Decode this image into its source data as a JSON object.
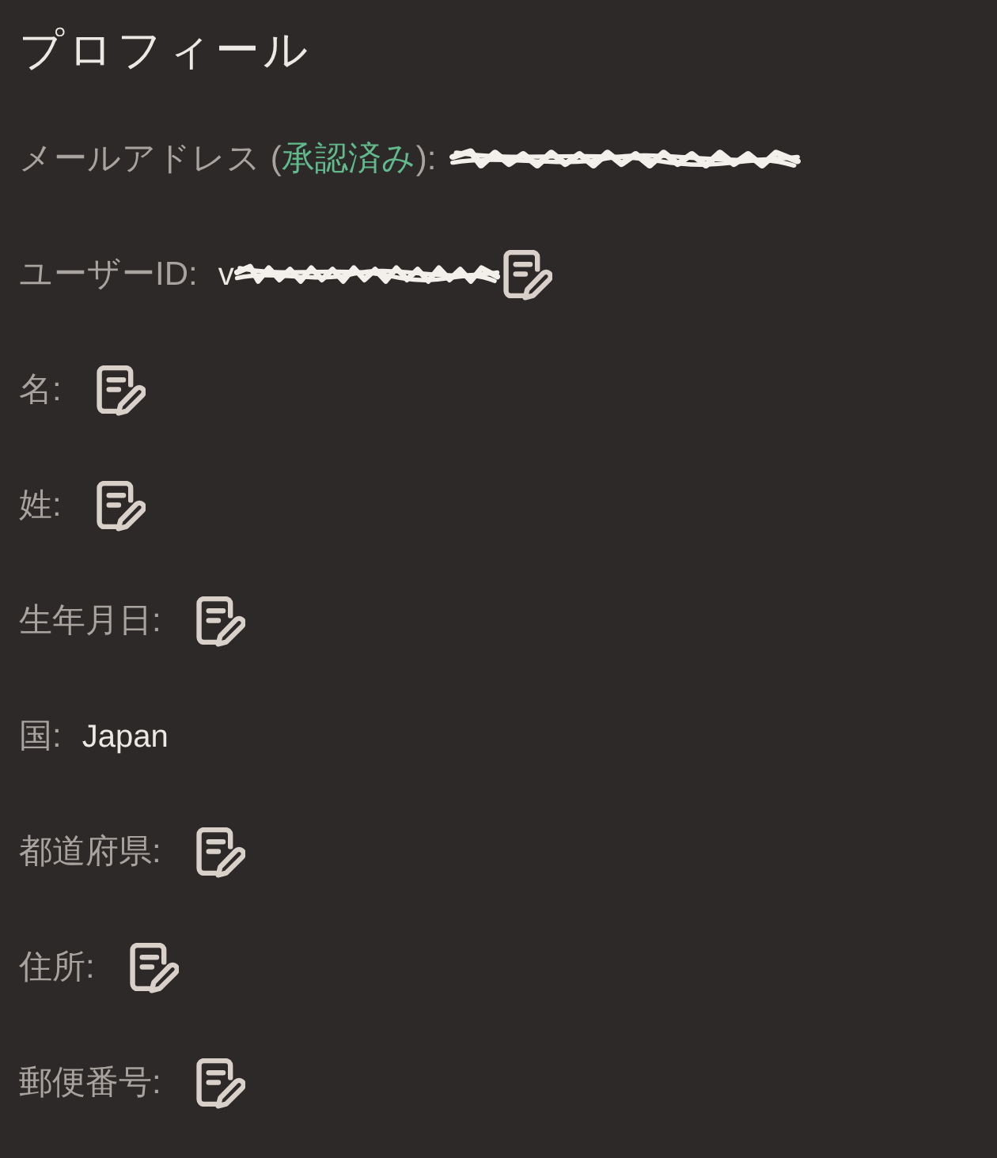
{
  "title": "プロフィール",
  "fields": [
    {
      "label_parts": [
        {
          "text": "メールアドレス (",
          "kind": "plain"
        },
        {
          "text": "承認済み",
          "kind": "status"
        },
        {
          "text": "):",
          "kind": "plain"
        }
      ],
      "redacted": true,
      "editable": false
    },
    {
      "label": "ユーザーID:",
      "value": "v",
      "redacted": true,
      "editable": true
    },
    {
      "label": "名:",
      "redacted": false,
      "editable": true
    },
    {
      "label": "姓:",
      "redacted": false,
      "editable": true
    },
    {
      "label": "生年月日:",
      "redacted": false,
      "editable": true
    },
    {
      "label": "国:",
      "value": "Japan",
      "redacted": false,
      "editable": false
    },
    {
      "label": "都道府県:",
      "redacted": false,
      "editable": true
    },
    {
      "label": "住所:",
      "redacted": false,
      "editable": true
    },
    {
      "label": "郵便番号:",
      "redacted": false,
      "editable": true
    }
  ]
}
